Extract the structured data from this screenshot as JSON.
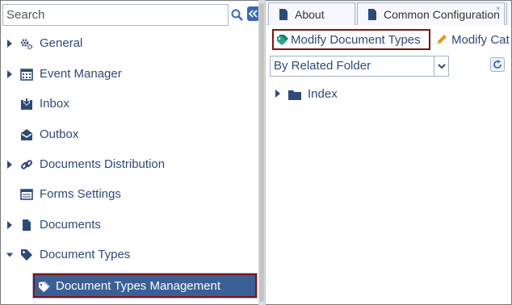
{
  "search": {
    "placeholder": "Search",
    "value": ""
  },
  "sidebar": {
    "items": [
      {
        "label": "General",
        "icon": "gears-icon",
        "expandable": true
      },
      {
        "label": "Event Manager",
        "icon": "calendar-icon",
        "expandable": true
      },
      {
        "label": "Inbox",
        "icon": "inbox-icon",
        "expandable": false
      },
      {
        "label": "Outbox",
        "icon": "outbox-icon",
        "expandable": false
      },
      {
        "label": "Documents Distribution",
        "icon": "link-icon",
        "expandable": true
      },
      {
        "label": "Forms Settings",
        "icon": "form-icon",
        "expandable": false
      },
      {
        "label": "Documents",
        "icon": "document-icon",
        "expandable": true
      },
      {
        "label": "Document Types",
        "icon": "tag-icon",
        "expandable": true,
        "expanded": true
      }
    ],
    "selected": {
      "label": "Document Types Management",
      "icon": "tags-icon"
    }
  },
  "tabs": [
    {
      "label": "About",
      "icon": "document-icon"
    },
    {
      "label": "Common Configuration",
      "icon": "document-icon",
      "close": "×"
    }
  ],
  "toolbar": {
    "modify_document_types": "Modify Document Types",
    "modify_categories": "Modify Cat"
  },
  "filter": {
    "selected": "By Related Folder"
  },
  "right_tree": {
    "items": [
      {
        "label": "Index",
        "icon": "folder-icon"
      }
    ]
  },
  "colors": {
    "accent": "#3a5f95",
    "highlight_border": "#7c1313",
    "text": "#2e4a78",
    "tag_green": "#2aa58a",
    "pencil_orange": "#e0962a"
  }
}
